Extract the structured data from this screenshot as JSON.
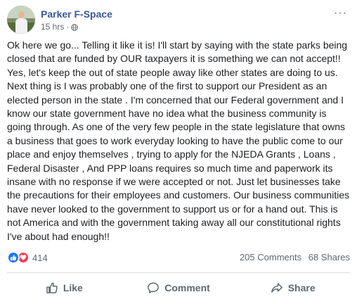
{
  "post": {
    "author": "Parker F-Space",
    "time": "15 hrs",
    "separator": "·",
    "audience_icon": "globe-icon",
    "more_icon": "more-options-icon",
    "more_label": "···",
    "text": "Ok here we go... Telling it like it is! I'll start by saying with the state parks being closed that are funded by OUR taxpayers it is something we can not accept!! Yes, let's keep the out of state people away like other states are doing to us. Next thing is I was probably one of the first to support our President as an elected person in the state . I'm concerned that our Federal government and I know our state government have no idea what the business community is going through. As one of the very few people in the state legislature that owns a business that goes to work everyday looking to have the public come to our place and enjoy themselves , trying to apply for the NJEDA Grants , Loans , Federal Disaster , And PPP loans requires so much time and paperwork its insane with no response if we were accepted or not. Just let businesses take the precautions for their employees and customers. Our business communities have never looked to the government to support us or for a hand out. This is not America and with the government taking away all our constitutional rights I've about had enough!!"
  },
  "stats": {
    "reactions": [
      "like-reaction-icon",
      "love-reaction-icon"
    ],
    "reaction_count": "414",
    "comments": "205 Comments",
    "shares": "68 Shares"
  },
  "actions": {
    "like": "Like",
    "comment": "Comment",
    "share": "Share"
  },
  "colors": {
    "author": "#385898",
    "meta": "#616770",
    "like_reaction": "#1877f2",
    "love_reaction": "#f33e58",
    "action_text": "#606770"
  }
}
